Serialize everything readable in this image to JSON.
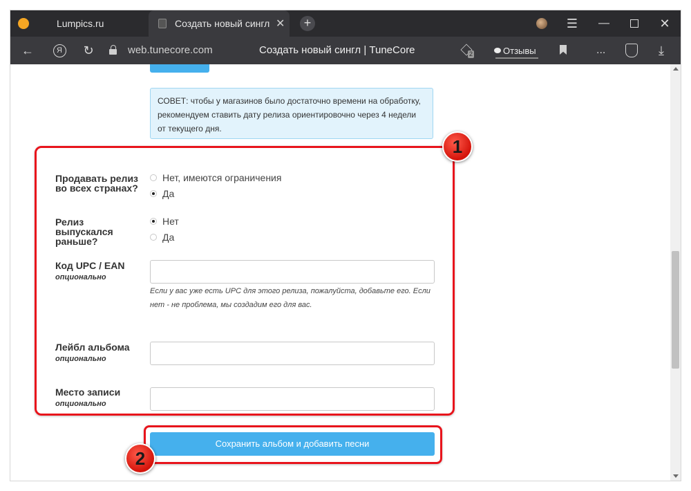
{
  "browser": {
    "tabs": [
      {
        "title": "Lumpics.ru"
      },
      {
        "title": "Создать новый сингл |"
      }
    ],
    "tab_close_glyph": "✕",
    "new_tab_glyph": "+",
    "url": "web.tunecore.com",
    "page_title": "Создать новый сингл | TuneCore",
    "extension_badge": "2",
    "reviews_label": "Отзывы",
    "more_glyph": "...",
    "window_menu_glyph": "☰",
    "minimize_glyph": "—",
    "close_glyph": "✕",
    "back_glyph": "←",
    "yandex_glyph": "Я",
    "reload_glyph": "↻",
    "download_glyph": "⤓"
  },
  "tip": {
    "text": "СОВЕТ: чтобы у магазинов было достаточно времени на обработку, рекомендуем ставить дату релиза ориентировочно через 4 недели от текущего дня."
  },
  "form": {
    "sell_all": {
      "label": "Продавать релиз во всех странах?",
      "options": [
        "Нет, имеются ограничения",
        "Да"
      ],
      "selected": "Да"
    },
    "released_before": {
      "label": "Релиз выпускался раньше?",
      "options": [
        "Нет",
        "Да"
      ],
      "selected": "Нет"
    },
    "upc": {
      "label": "Код UPC / EAN",
      "sublabel": "опционально",
      "value": "",
      "help": "Если у вас уже есть UPC для этого релиза, пожалуйста, добавьте его. Если нет - не проблема, мы создадим его для вас."
    },
    "label_field": {
      "label": "Лейбл альбома",
      "sublabel": "опционально",
      "value": ""
    },
    "recording_place": {
      "label": "Место записи",
      "sublabel": "опционально",
      "value": ""
    },
    "save_button": "Сохранить альбом и добавить песни"
  },
  "annotations": {
    "marker1": "1",
    "marker2": "2"
  },
  "colors": {
    "accent_blue": "#45b0ed",
    "highlight_red": "#e8141c",
    "tip_bg": "#e2f3fc"
  }
}
